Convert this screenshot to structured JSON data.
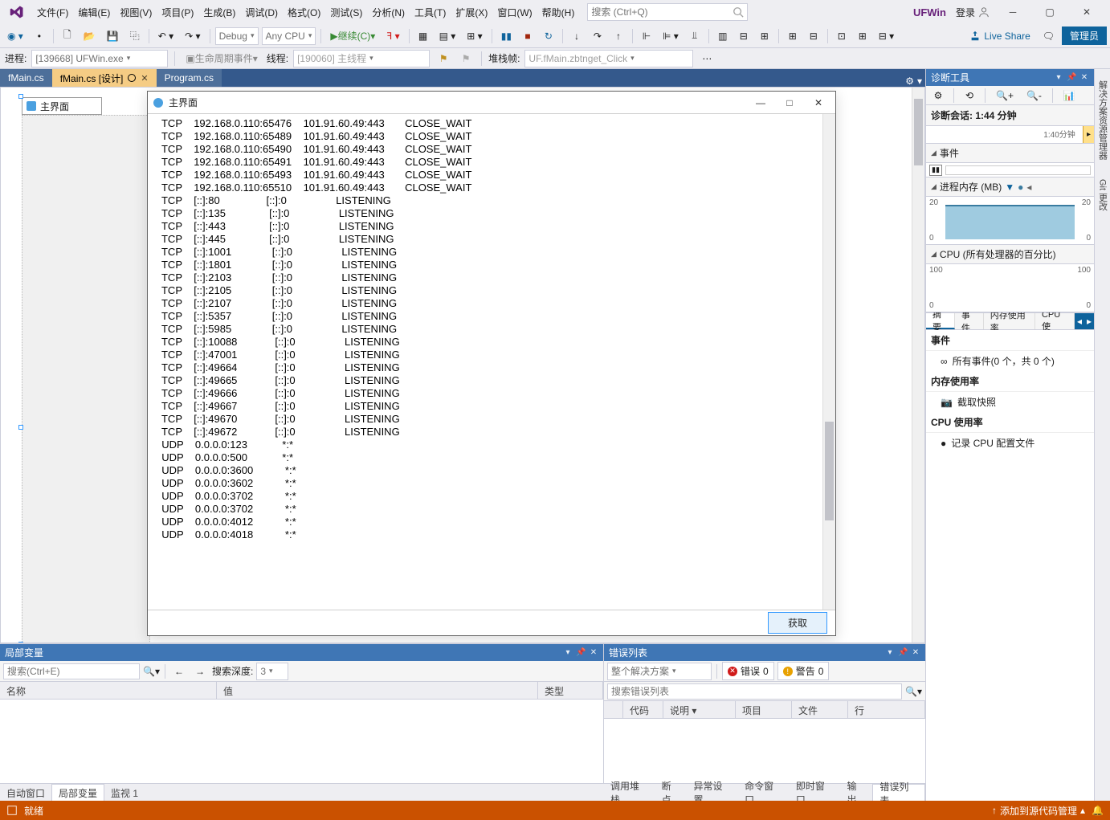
{
  "menu": [
    "文件(F)",
    "编辑(E)",
    "视图(V)",
    "项目(P)",
    "生成(B)",
    "调试(D)",
    "格式(O)",
    "测试(S)",
    "分析(N)",
    "工具(T)",
    "扩展(X)",
    "窗口(W)",
    "帮助(H)"
  ],
  "search_placeholder": "搜索 (Ctrl+Q)",
  "brand": "UFWin",
  "login": "登录",
  "toolbar": {
    "config": "Debug",
    "platform": "Any CPU",
    "continue": "继续(C)",
    "liveshare": "Live Share",
    "admin": "管理员"
  },
  "debugbar": {
    "process_label": "进程:",
    "process_value": "[139668] UFWin.exe",
    "lifecycle": "生命周期事件",
    "thread_label": "线程:",
    "thread_value": "[190060] 主线程",
    "stackframe_label": "堆栈帧:",
    "stackframe_value": "UF.fMain.zbtnget_Click"
  },
  "editor_tabs": [
    {
      "label": "fMain.cs",
      "active": false
    },
    {
      "label": "fMain.cs [设计]",
      "active": true
    },
    {
      "label": "Program.cs",
      "active": false
    }
  ],
  "outer_window_title": "主界面",
  "inner_window_title": "主界面",
  "fetch_button": "获取",
  "netstat_rows": [
    {
      "proto": "TCP",
      "local": "192.168.0.110:65476",
      "remote": "101.91.60.49:443",
      "state": "CLOSE_WAIT"
    },
    {
      "proto": "TCP",
      "local": "192.168.0.110:65489",
      "remote": "101.91.60.49:443",
      "state": "CLOSE_WAIT"
    },
    {
      "proto": "TCP",
      "local": "192.168.0.110:65490",
      "remote": "101.91.60.49:443",
      "state": "CLOSE_WAIT"
    },
    {
      "proto": "TCP",
      "local": "192.168.0.110:65491",
      "remote": "101.91.60.49:443",
      "state": "CLOSE_WAIT"
    },
    {
      "proto": "TCP",
      "local": "192.168.0.110:65493",
      "remote": "101.91.60.49:443",
      "state": "CLOSE_WAIT"
    },
    {
      "proto": "TCP",
      "local": "192.168.0.110:65510",
      "remote": "101.91.60.49:443",
      "state": "CLOSE_WAIT"
    },
    {
      "proto": "TCP",
      "local": "[::]:80",
      "remote": "[::]:0",
      "state": "LISTENING"
    },
    {
      "proto": "TCP",
      "local": "[::]:135",
      "remote": "[::]:0",
      "state": "LISTENING"
    },
    {
      "proto": "TCP",
      "local": "[::]:443",
      "remote": "[::]:0",
      "state": "LISTENING"
    },
    {
      "proto": "TCP",
      "local": "[::]:445",
      "remote": "[::]:0",
      "state": "LISTENING"
    },
    {
      "proto": "TCP",
      "local": "[::]:1001",
      "remote": "[::]:0",
      "state": "LISTENING"
    },
    {
      "proto": "TCP",
      "local": "[::]:1801",
      "remote": "[::]:0",
      "state": "LISTENING"
    },
    {
      "proto": "TCP",
      "local": "[::]:2103",
      "remote": "[::]:0",
      "state": "LISTENING"
    },
    {
      "proto": "TCP",
      "local": "[::]:2105",
      "remote": "[::]:0",
      "state": "LISTENING"
    },
    {
      "proto": "TCP",
      "local": "[::]:2107",
      "remote": "[::]:0",
      "state": "LISTENING"
    },
    {
      "proto": "TCP",
      "local": "[::]:5357",
      "remote": "[::]:0",
      "state": "LISTENING"
    },
    {
      "proto": "TCP",
      "local": "[::]:5985",
      "remote": "[::]:0",
      "state": "LISTENING"
    },
    {
      "proto": "TCP",
      "local": "[::]:10088",
      "remote": "[::]:0",
      "state": "LISTENING"
    },
    {
      "proto": "TCP",
      "local": "[::]:47001",
      "remote": "[::]:0",
      "state": "LISTENING"
    },
    {
      "proto": "TCP",
      "local": "[::]:49664",
      "remote": "[::]:0",
      "state": "LISTENING"
    },
    {
      "proto": "TCP",
      "local": "[::]:49665",
      "remote": "[::]:0",
      "state": "LISTENING"
    },
    {
      "proto": "TCP",
      "local": "[::]:49666",
      "remote": "[::]:0",
      "state": "LISTENING"
    },
    {
      "proto": "TCP",
      "local": "[::]:49667",
      "remote": "[::]:0",
      "state": "LISTENING"
    },
    {
      "proto": "TCP",
      "local": "[::]:49670",
      "remote": "[::]:0",
      "state": "LISTENING"
    },
    {
      "proto": "TCP",
      "local": "[::]:49672",
      "remote": "[::]:0",
      "state": "LISTENING"
    },
    {
      "proto": "UDP",
      "local": "0.0.0.0:123",
      "remote": "*:*",
      "state": ""
    },
    {
      "proto": "UDP",
      "local": "0.0.0.0:500",
      "remote": "*:*",
      "state": ""
    },
    {
      "proto": "UDP",
      "local": "0.0.0.0:3600",
      "remote": "*:*",
      "state": ""
    },
    {
      "proto": "UDP",
      "local": "0.0.0.0:3602",
      "remote": "*:*",
      "state": ""
    },
    {
      "proto": "UDP",
      "local": "0.0.0.0:3702",
      "remote": "*:*",
      "state": ""
    },
    {
      "proto": "UDP",
      "local": "0.0.0.0:3702",
      "remote": "*:*",
      "state": ""
    },
    {
      "proto": "UDP",
      "local": "0.0.0.0:4012",
      "remote": "*:*",
      "state": ""
    },
    {
      "proto": "UDP",
      "local": "0.0.0.0:4018",
      "remote": "*:*",
      "state": ""
    }
  ],
  "diag": {
    "title": "诊断工具",
    "session": "诊断会话: 1:44 分钟",
    "ruler_mark": "1:40分钟",
    "events_hdr": "事件",
    "mem_hdr": "进程内存 (MB)",
    "mem_max": "20",
    "mem_min": "0",
    "cpu_hdr": "CPU (所有处理器的百分比)",
    "cpu_max": "100",
    "cpu_min": "0",
    "tabs": [
      "摘要",
      "事件",
      "内存使用率",
      "CPU 使"
    ],
    "event_group": "事件",
    "event_item": "所有事件(0 个，共 0 个)",
    "mem_group": "内存使用率",
    "mem_item": "截取快照",
    "cpu_group": "CPU 使用率",
    "cpu_item": "记录 CPU 配置文件"
  },
  "side_tabs": [
    "解决方案资源管理器",
    "Git 更改"
  ],
  "locals": {
    "title": "局部变量",
    "search_placeholder": "搜索(Ctrl+E)",
    "depth_label": "搜索深度:",
    "depth_value": "3",
    "cols": [
      "名称",
      "值",
      "类型"
    ],
    "bottom_tabs": [
      "自动窗口",
      "局部变量",
      "监视 1"
    ]
  },
  "errors": {
    "title": "错误列表",
    "scope": "整个解决方案",
    "err_label": "错误",
    "err_count": "0",
    "warn_label": "警告",
    "warn_count": "0",
    "search_placeholder": "搜索错误列表",
    "cols": [
      "",
      "代码",
      "说明",
      "项目",
      "文件",
      "行"
    ],
    "bottom_tabs": [
      "调用堆栈",
      "断点",
      "异常设置",
      "命令窗口",
      "即时窗口",
      "输出",
      "错误列表"
    ]
  },
  "status": {
    "ready": "就绪",
    "scm": "添加到源代码管理"
  },
  "chart_data": [
    {
      "type": "area",
      "title": "进程内存 (MB)",
      "ylim": [
        0,
        20
      ],
      "x": [
        0,
        104
      ],
      "series": [
        {
          "name": "Memory",
          "values": [
            19,
            19
          ]
        }
      ]
    },
    {
      "type": "line",
      "title": "CPU (所有处理器的百分比)",
      "ylim": [
        0,
        100
      ],
      "x": [
        0,
        104
      ],
      "series": [
        {
          "name": "CPU",
          "values": [
            0,
            0
          ]
        }
      ]
    }
  ]
}
